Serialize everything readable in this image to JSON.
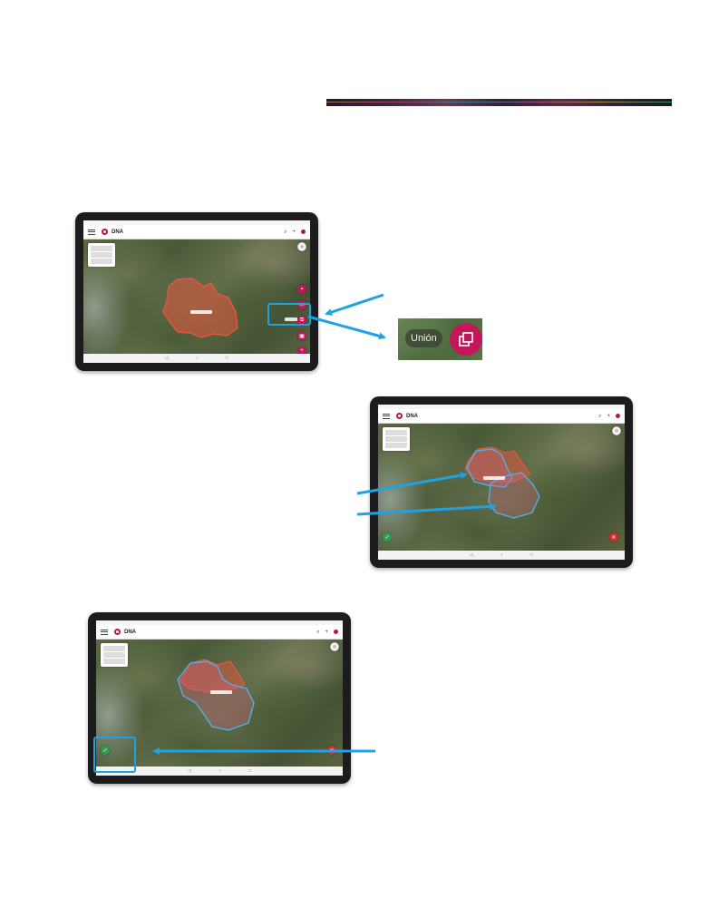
{
  "colors": {
    "accent": "#1fa2e4",
    "brand": "#c2185b",
    "confirm": "#2e9e4a",
    "cancel": "#d32f2f",
    "polygon_original": "#e8553f",
    "polygon_new": "#4fb0e8"
  },
  "app": {
    "title": "DNA",
    "icons": [
      "menu-icon",
      "search-icon",
      "add-icon",
      "profile-icon"
    ]
  },
  "zoom_callout": {
    "label": "Unión",
    "button_icon": "union-icon"
  },
  "screens": [
    {
      "id": "union-button-screen",
      "fabs": [
        "lock-icon",
        "scissors-icon",
        "union-icon",
        "save-icon",
        "add-icon"
      ]
    },
    {
      "id": "union-preview-screen",
      "fabs": [
        "confirm-icon",
        "cancel-icon"
      ]
    },
    {
      "id": "union-confirm-screen",
      "fabs": [
        "confirm-icon",
        "cancel-icon"
      ]
    }
  ]
}
